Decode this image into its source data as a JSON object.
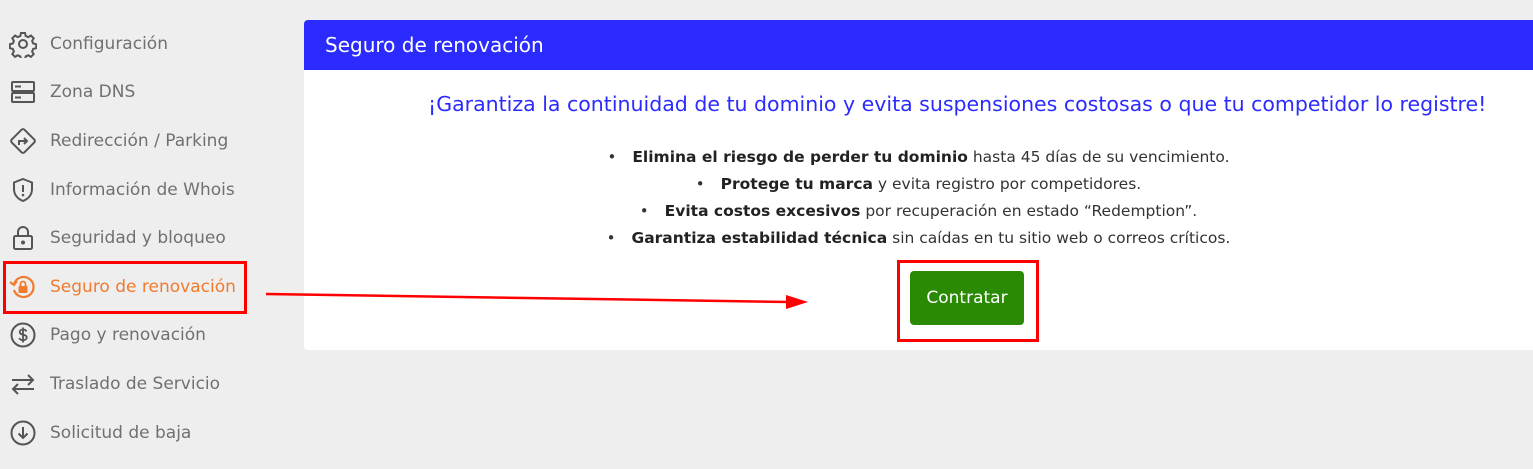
{
  "sidebar": {
    "items": [
      {
        "label": "Configuración",
        "icon": "gear-icon"
      },
      {
        "label": "Zona DNS",
        "icon": "server-icon"
      },
      {
        "label": "Redirección / Parking",
        "icon": "redirect-icon"
      },
      {
        "label": "Información de Whois",
        "icon": "shield-icon"
      },
      {
        "label": "Seguridad y bloqueo",
        "icon": "lock-icon"
      },
      {
        "label": "Seguro de renovación",
        "icon": "renewal-lock-icon",
        "active": true
      },
      {
        "label": "Pago y renovación",
        "icon": "dollar-icon"
      },
      {
        "label": "Traslado de Servicio",
        "icon": "transfer-icon"
      },
      {
        "label": "Solicitud de baja",
        "icon": "download-circle-icon"
      }
    ]
  },
  "card": {
    "title": "Seguro de renovación",
    "headline": "¡Garantiza la continuidad de tu dominio y evita suspensiones costosas o que tu competidor lo registre!",
    "bullets": [
      {
        "bold": "Elimina el riesgo de perder tu dominio",
        "rest": " hasta 45 días de su vencimiento."
      },
      {
        "bold": "Protege tu marca",
        "rest": " y evita registro por competidores."
      },
      {
        "bold": "Evita costos excesivos",
        "rest": " por recuperación en estado “Redemption”."
      },
      {
        "bold": "Garantiza estabilidad técnica",
        "rest": " sin caídas en tu sitio web o correos críticos."
      }
    ],
    "button_label": "Contratar"
  },
  "colors": {
    "header_bg": "#2b2bff",
    "headline": "#2b2bff",
    "active_item": "#f07a2e",
    "button": "#2a8a04",
    "annotation": "#ff0000"
  }
}
